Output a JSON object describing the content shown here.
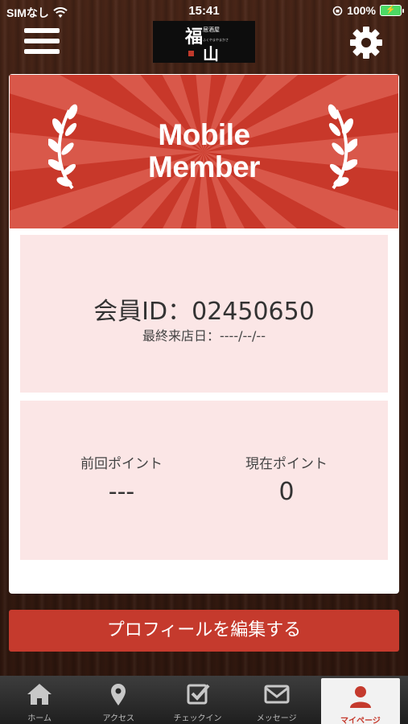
{
  "status_bar": {
    "carrier": "SIMなし",
    "time": "15:41",
    "battery_percent": "100%"
  },
  "header": {
    "logo": {
      "char_main": "福",
      "char_small": "居酒屋",
      "char_second": "山",
      "subtitle": "ふくやまやまかさ"
    },
    "menu_icon": "hamburger-icon",
    "settings_icon": "gear-icon"
  },
  "member_card": {
    "banner_title_line1": "Mobile",
    "banner_title_line2": "Member",
    "member_id": "会員ID：02450650",
    "last_visit": "最終来店日：----/--/--",
    "points": {
      "previous_label": "前回ポイント",
      "previous_value": "---",
      "current_label": "現在ポイント",
      "current_value": "0"
    }
  },
  "edit_profile_label": "プロフィールを編集する",
  "tabbar": {
    "tabs": [
      {
        "label": "ホーム",
        "icon": "home-icon"
      },
      {
        "label": "アクセス",
        "icon": "map-pin-icon"
      },
      {
        "label": "チェックイン",
        "icon": "checkbox-icon"
      },
      {
        "label": "メッセージ",
        "icon": "envelope-icon"
      },
      {
        "label": "マイページ",
        "icon": "user-icon",
        "active": true
      }
    ]
  },
  "colors": {
    "brand_red": "#c53a2d",
    "panel_pink": "#fbe6e6",
    "battery_green": "#4cd964"
  }
}
